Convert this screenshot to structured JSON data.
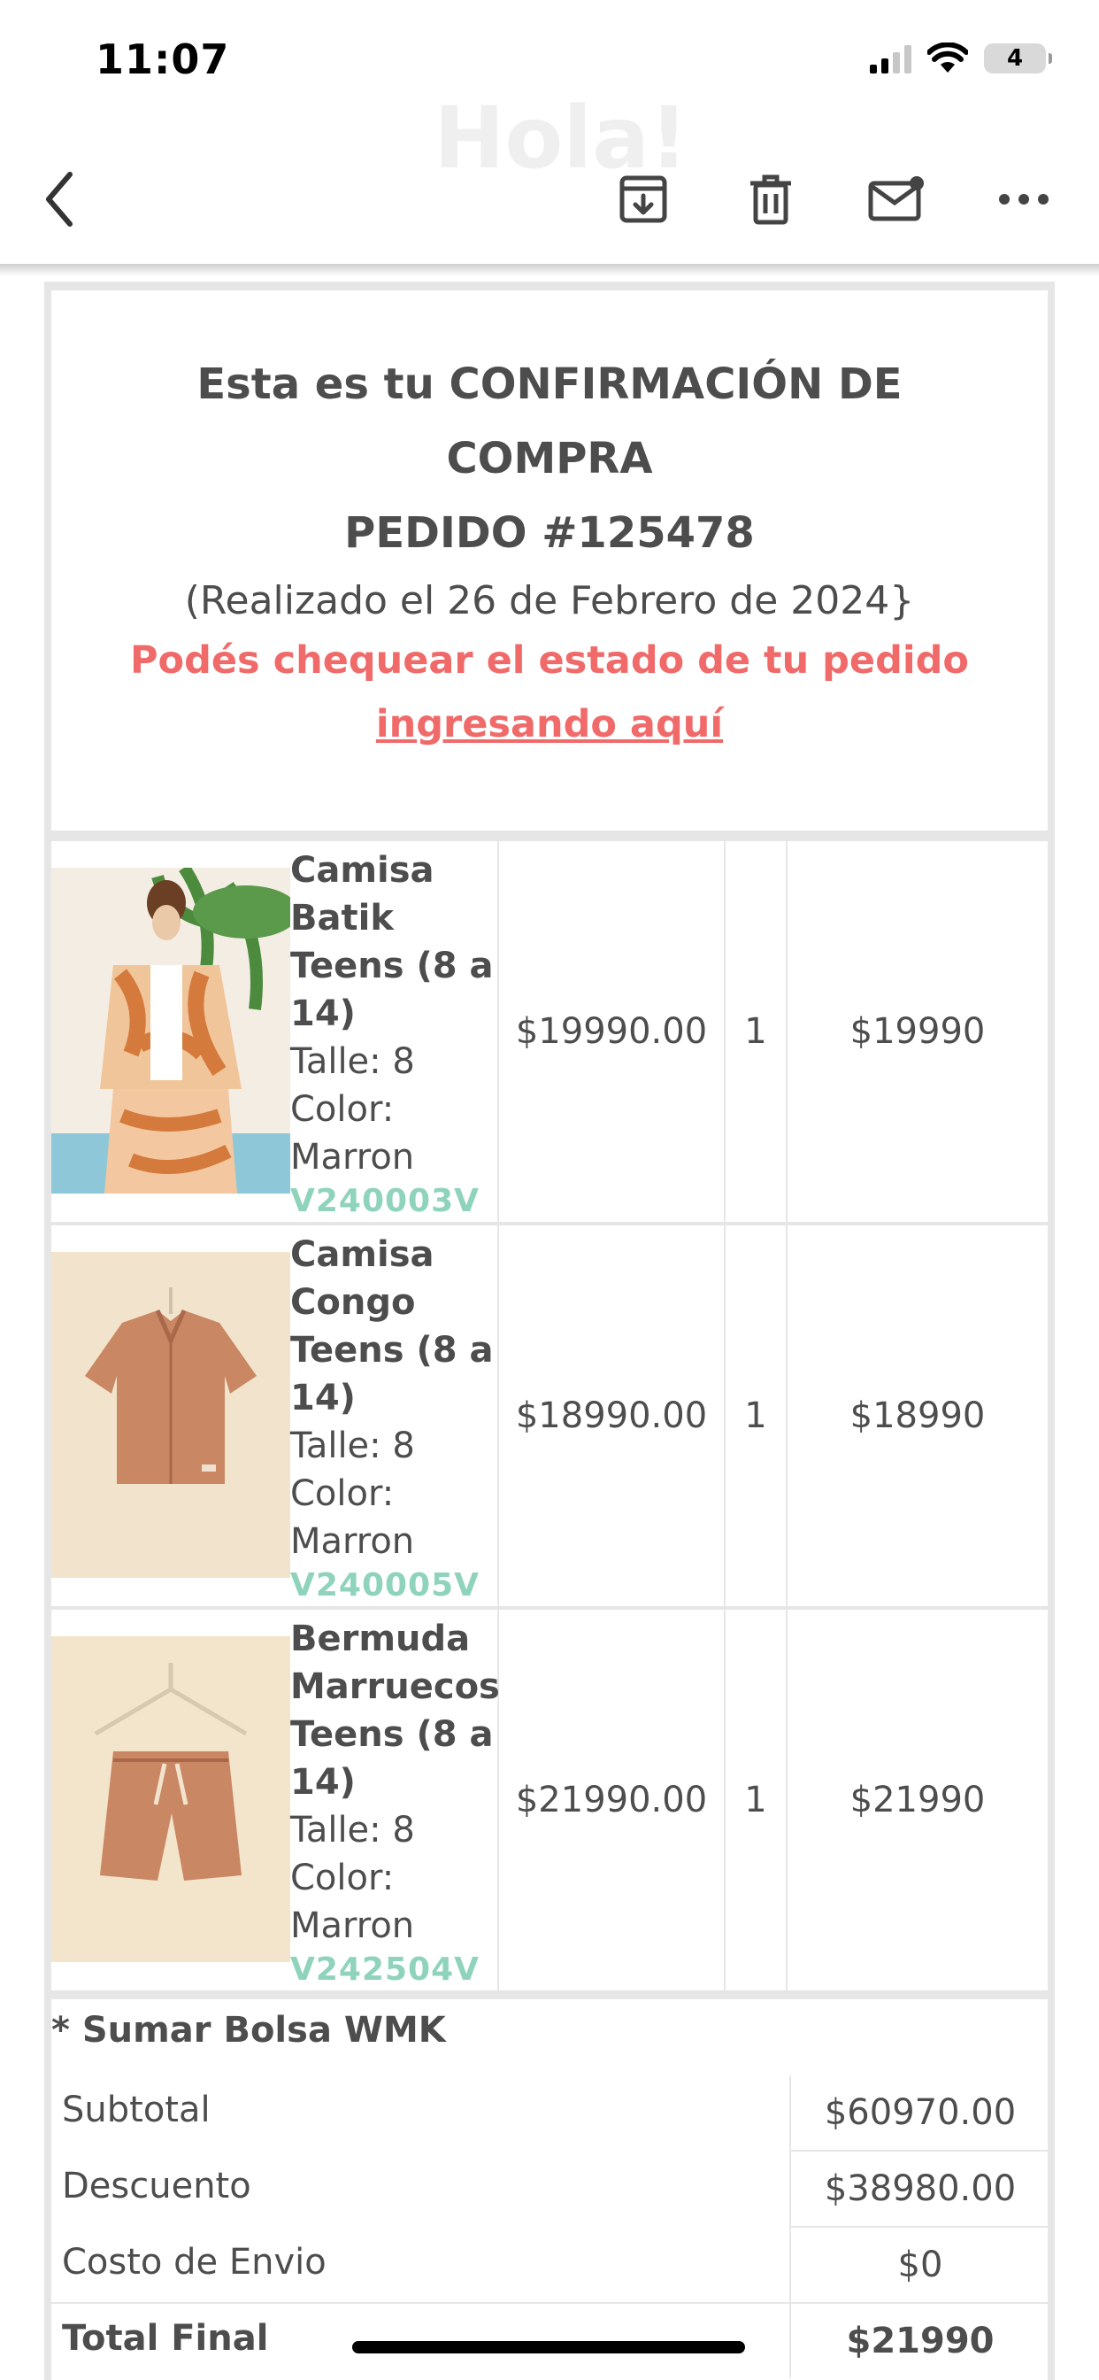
{
  "status_bar": {
    "time": "11:07",
    "battery": "4"
  },
  "background_text": "Hola!",
  "toolbar": {
    "icons": [
      "back-icon",
      "archive-icon",
      "trash-icon",
      "mail-unread-icon",
      "more-icon"
    ]
  },
  "header": {
    "title_line1": "Esta es tu CONFIRMACIÓN DE",
    "title_line2": "COMPRA",
    "order": "PEDIDO #125478",
    "placed": "(Realizado el 26 de Febrero de 2024}",
    "check_text": "Podés chequear el estado de tu pedido",
    "check_link": "ingresando aquí"
  },
  "items": [
    {
      "name_lines": [
        "Camisa",
        "Batik",
        "Teens (8 a",
        "14)"
      ],
      "size": "Talle: 8",
      "color_lines": [
        "Color:",
        "Marron"
      ],
      "code": "V240003V",
      "price": "$19990.00",
      "qty": "1",
      "total": "$19990"
    },
    {
      "name_lines": [
        "Camisa",
        "Congo",
        "Teens (8 a",
        "14)"
      ],
      "size": "Talle: 8",
      "color_lines": [
        "Color:",
        "Marron"
      ],
      "code": "V240005V",
      "price": "$18990.00",
      "qty": "1",
      "total": "$18990"
    },
    {
      "name_lines": [
        "Bermuda",
        "Marruecos",
        "Teens (8 a",
        "14)"
      ],
      "size": "Talle: 8",
      "color_lines": [
        "Color:",
        "Marron"
      ],
      "code": "V242504V",
      "price": "$21990.00",
      "qty": "1",
      "total": "$21990"
    }
  ],
  "summary": {
    "bolsa": "* Sumar Bolsa WMK",
    "subtotal_label": "Subtotal",
    "subtotal": "$60970.00",
    "descuento_label": "Descuento",
    "descuento": "$38980.00",
    "envio_label": "Costo de Envio",
    "envio": "$0",
    "total_label": "Total Final",
    "total": "$21990"
  },
  "colors": {
    "link": "#f06a6a",
    "code": "#8fd3bb",
    "text": "#4d4d4d",
    "border": "#e6e6e6"
  }
}
